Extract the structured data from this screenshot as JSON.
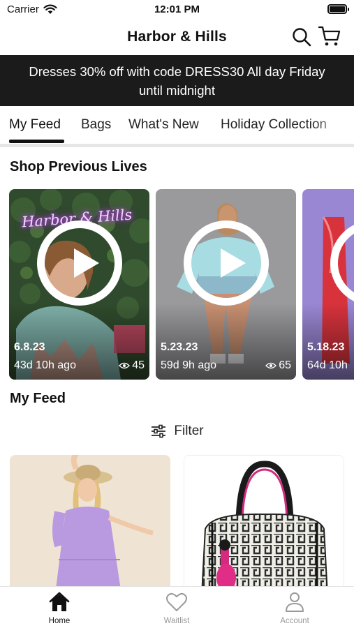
{
  "status_bar": {
    "carrier": "Carrier",
    "time": "12:01 PM"
  },
  "header": {
    "title": "Harbor & Hills"
  },
  "promo": {
    "line1": "Dresses 30% off with code DRESS30 All day Friday",
    "line2": "until midnight"
  },
  "tabs": [
    {
      "label": "My Feed",
      "active": true
    },
    {
      "label": "Bags",
      "active": false
    },
    {
      "label": "What's New",
      "active": false
    },
    {
      "label": "Holiday Collection",
      "active": false
    }
  ],
  "lives": {
    "title": "Shop Previous Lives",
    "items": [
      {
        "date": "6.8.23",
        "ago": "43d 10h ago",
        "views": "45",
        "neon_text": "Harbor & Hills"
      },
      {
        "date": "5.23.23",
        "ago": "59d 9h ago",
        "views": "65"
      },
      {
        "date": "5.18.23",
        "ago": "64d 10h",
        "views": ""
      }
    ]
  },
  "feed": {
    "title": "My Feed",
    "filter_label": "Filter"
  },
  "bottom_nav": [
    {
      "label": "Home",
      "icon": "home-icon",
      "active": true
    },
    {
      "label": "Waitlist",
      "icon": "heart-icon",
      "active": false
    },
    {
      "label": "Account",
      "icon": "person-icon",
      "active": false
    }
  ],
  "colors": {
    "banner_bg": "#1b1b1b",
    "accent": "#111111",
    "inactive": "#9a9a9a"
  }
}
